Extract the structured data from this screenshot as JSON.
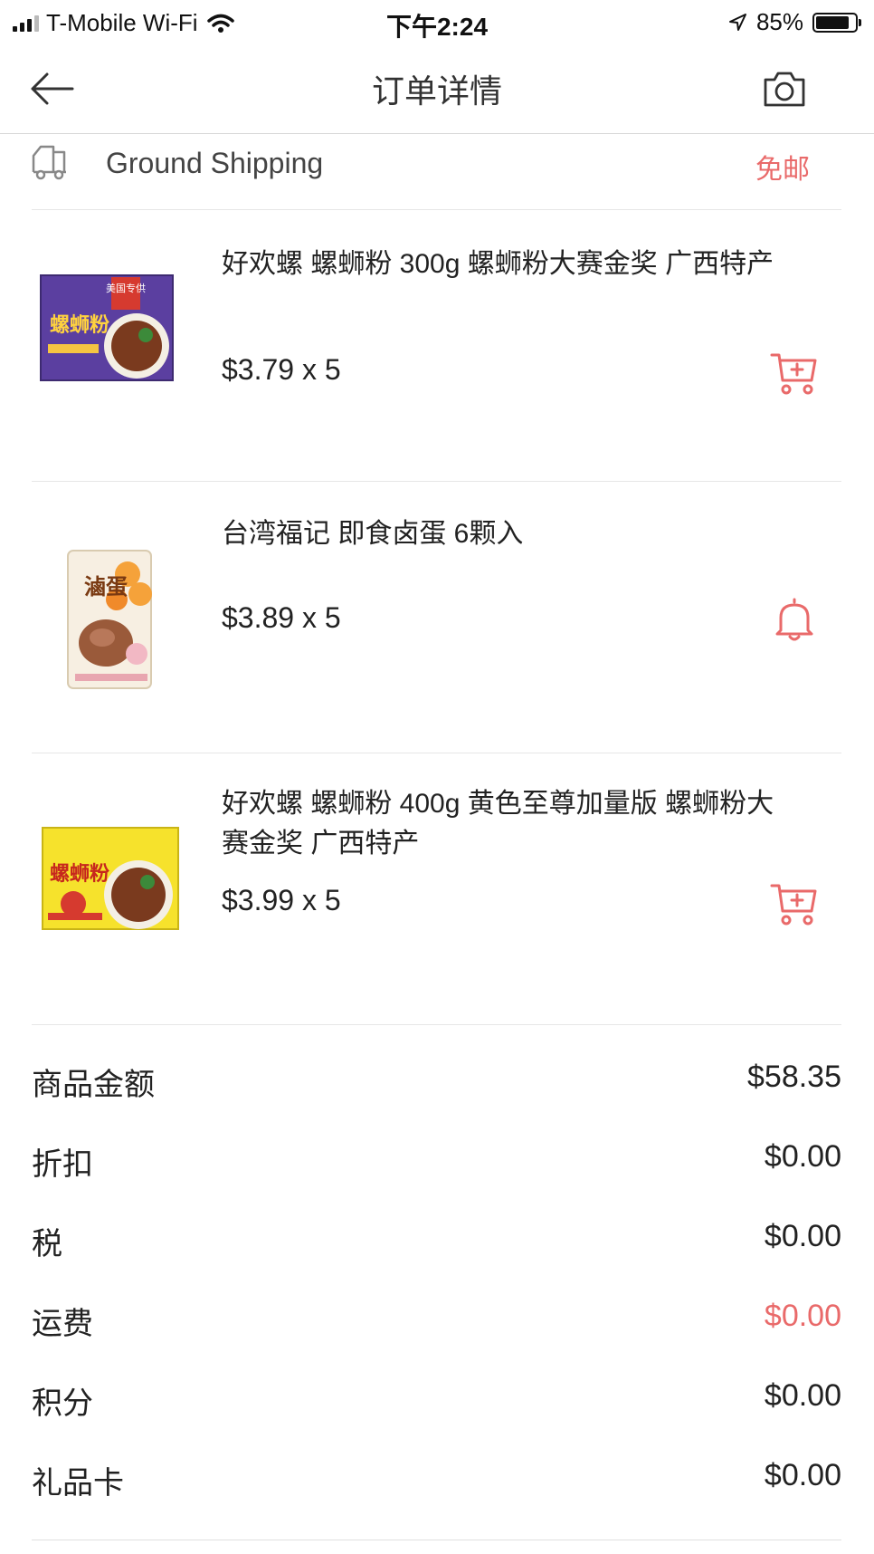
{
  "status_bar": {
    "carrier": "T-Mobile Wi-Fi",
    "time": "下午2:24",
    "battery": "85%",
    "battery_level": 0.85
  },
  "nav": {
    "title": "订单详情"
  },
  "shipping": {
    "label": "Ground Shipping",
    "fee": "免邮"
  },
  "items": [
    {
      "name": "好欢螺 螺蛳粉 300g 螺蛳粉大赛金奖 广西特产",
      "price": "$3.79 x 5",
      "action_icon": "add-to-cart-icon",
      "thumb_text": "螺蛳粉",
      "thumb_badge": "美国专供"
    },
    {
      "name": "台湾福记 即食卤蛋 6颗入",
      "price": "$3.89 x 5",
      "action_icon": "bell-icon",
      "thumb_text": "滷蛋"
    },
    {
      "name": "好欢螺 螺蛳粉 400g 黄色至尊加量版 螺蛳粉大赛金奖 广西特产",
      "price": "$3.99 x 5",
      "action_icon": "add-to-cart-icon",
      "thumb_text": "螺蛳粉"
    }
  ],
  "totals": [
    {
      "label": "商品金额",
      "value": "$58.35"
    },
    {
      "label": "折扣",
      "value": "$0.00"
    },
    {
      "label": "税",
      "value": "$0.00"
    },
    {
      "label": "运费",
      "value": "$0.00"
    },
    {
      "label": "积分",
      "value": "$0.00"
    },
    {
      "label": "礼品卡",
      "value": "$0.00"
    }
  ],
  "colors": {
    "accent": "#e96a6a",
    "text": "#222222",
    "divider": "#e6e6e6"
  }
}
